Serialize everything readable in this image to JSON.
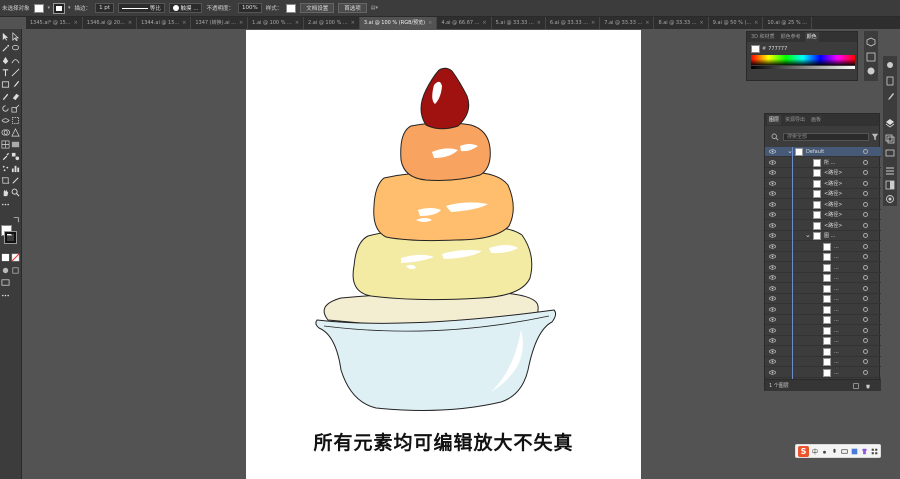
{
  "control_bar": {
    "selection_label": "未选择对象",
    "stroke_label": "描边：",
    "stroke_width": "1 pt",
    "stroke_profile": "等比",
    "brush_label": "触摸 ...",
    "opacity_label": "不透明度：",
    "opacity_value": "100%",
    "style_label": "样式：",
    "doc_setup_button": "文档设置",
    "preferences_button": "首选项"
  },
  "tabs": [
    {
      "label": "1345.ai* @ 15...",
      "active": false
    },
    {
      "label": "1346.ai @ 20...",
      "active": false
    },
    {
      "label": "1344.ai @ 15...",
      "active": false
    },
    {
      "label": "1347 (转换).ai ...",
      "active": false
    },
    {
      "label": "1.ai @ 100 % ...",
      "active": false
    },
    {
      "label": "2.ai @ 100 % ...",
      "active": false
    },
    {
      "label": "3.ai @ 100 % (RGB/预览)",
      "active": true
    },
    {
      "label": "4.ai @ 66.67 ...",
      "active": false
    },
    {
      "label": "5.ai @ 33.33 ...",
      "active": false
    },
    {
      "label": "6.ai @ 33.33 ...",
      "active": false
    },
    {
      "label": "7.ai @ 33.33 ...",
      "active": false
    },
    {
      "label": "8.ai @ 33.33 ...",
      "active": false
    },
    {
      "label": "9.ai @ 50 % (...",
      "active": false
    },
    {
      "label": "10.ai @ 25 % ...",
      "active": false
    }
  ],
  "artboard": {
    "caption": "所有元素均可编辑放大不失真"
  },
  "color_panel": {
    "tabs": [
      "3D 和材质",
      "颜色参考",
      "颜色"
    ],
    "active_tab": "颜色",
    "hex_value": "777777"
  },
  "layers_panel": {
    "tabs": [
      "图层",
      "资源导出",
      "画板"
    ],
    "active_tab": "图层",
    "search_placeholder": "搜索全部",
    "rows": [
      {
        "name": "Default",
        "level": 0,
        "expanded": true
      },
      {
        "name": "所 ...",
        "level": 1
      },
      {
        "name": "<路径>",
        "level": 1
      },
      {
        "name": "<路径>",
        "level": 1
      },
      {
        "name": "<路径>",
        "level": 1
      },
      {
        "name": "<路径>",
        "level": 1
      },
      {
        "name": "<路径>",
        "level": 1
      },
      {
        "name": "<路径>",
        "level": 1
      },
      {
        "name": "图 ...",
        "level": 1,
        "expanded": true
      },
      {
        "name": "...",
        "level": 2
      },
      {
        "name": "...",
        "level": 2
      },
      {
        "name": "...",
        "level": 2
      },
      {
        "name": "...",
        "level": 2
      },
      {
        "name": "...",
        "level": 2
      },
      {
        "name": "...",
        "level": 2
      },
      {
        "name": "...",
        "level": 2
      },
      {
        "name": "...",
        "level": 2
      },
      {
        "name": "...",
        "level": 2
      },
      {
        "name": "...",
        "level": 2
      },
      {
        "name": "...",
        "level": 2
      },
      {
        "name": "...",
        "level": 2
      },
      {
        "name": "...",
        "level": 2
      }
    ],
    "layer_count": "1 个图层"
  },
  "ime_bar": {
    "logo": "S",
    "mode": "中"
  }
}
